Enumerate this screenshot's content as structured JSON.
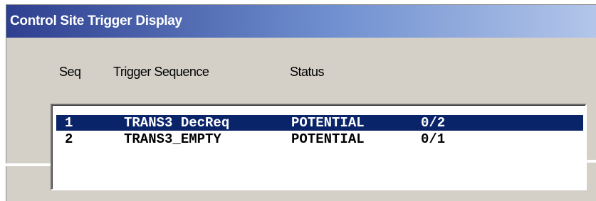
{
  "window": {
    "title": "Control Site Trigger Display"
  },
  "columns": {
    "seq": "Seq",
    "trigger_sequence": "Trigger Sequence",
    "status": "Status"
  },
  "rows": [
    {
      "seq": "1",
      "trigger": "TRANS3 DecReq",
      "status": "POTENTIAL",
      "count": "0/2",
      "selected": true
    },
    {
      "seq": "2",
      "trigger": "TRANS3_EMPTY",
      "status": "POTENTIAL",
      "count": "0/1",
      "selected": false
    }
  ],
  "colors": {
    "selection_background": "#0a246a",
    "title_gradient_start": "#2e3f8f",
    "dialog_background": "#d4d0c8"
  }
}
